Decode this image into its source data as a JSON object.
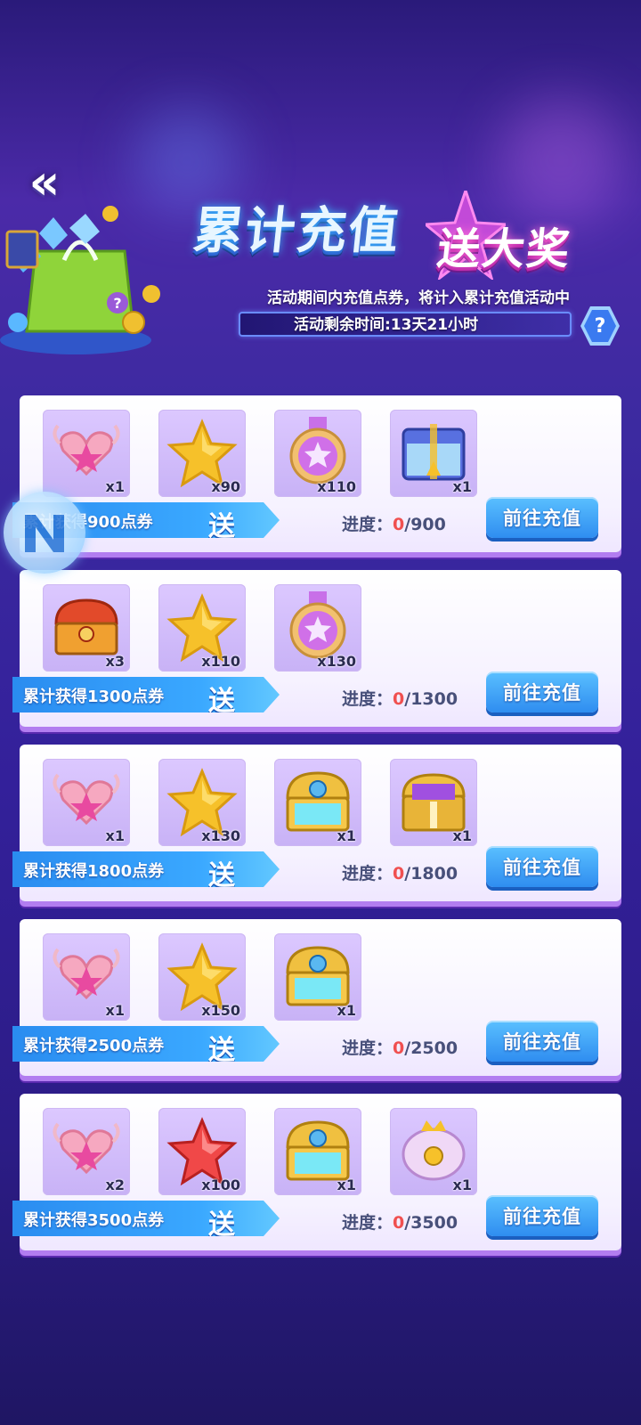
{
  "header": {
    "back_icon": "double-chevron-left-icon",
    "title": "累计充值",
    "subtitle": "送大奖",
    "info": "活动期间内充值点券，将计入累计充值活动中",
    "timer": "活动剩余时间:13天21小时",
    "help_label": "?"
  },
  "tiers": [
    {
      "ribbon": "累计获得900点券",
      "send": "送",
      "progress_label": "进度：",
      "progress_current": "0",
      "progress_target": "/900",
      "button": "前往充值",
      "items": [
        {
          "icon": "wing-heart-icon",
          "qty": "x1"
        },
        {
          "icon": "gold-star-icon",
          "qty": "x90"
        },
        {
          "icon": "star-medal-icon",
          "qty": "x110"
        },
        {
          "icon": "blue-chest-icon",
          "qty": "x1"
        }
      ]
    },
    {
      "ribbon": "累计获得1300点券",
      "send": "送",
      "progress_label": "进度：",
      "progress_current": "0",
      "progress_target": "/1300",
      "button": "前往充值",
      "items": [
        {
          "icon": "red-chest-icon",
          "qty": "x3"
        },
        {
          "icon": "gold-star-icon",
          "qty": "x110"
        },
        {
          "icon": "star-medal-icon",
          "qty": "x130"
        }
      ]
    },
    {
      "ribbon": "累计获得1800点券",
      "send": "送",
      "progress_label": "进度：",
      "progress_current": "0",
      "progress_target": "/1800",
      "button": "前往充值",
      "items": [
        {
          "icon": "wing-heart-icon",
          "qty": "x1"
        },
        {
          "icon": "gold-star-icon",
          "qty": "x130"
        },
        {
          "icon": "gold-crystal-chest-icon",
          "qty": "x1"
        },
        {
          "icon": "purple-gold-chest-icon",
          "qty": "x1"
        }
      ]
    },
    {
      "ribbon": "累计获得2500点券",
      "send": "送",
      "progress_label": "进度：",
      "progress_current": "0",
      "progress_target": "/2500",
      "button": "前往充值",
      "items": [
        {
          "icon": "wing-heart-icon",
          "qty": "x1"
        },
        {
          "icon": "gold-star-icon",
          "qty": "x150"
        },
        {
          "icon": "gold-crystal-chest-icon",
          "qty": "x1"
        }
      ]
    },
    {
      "ribbon": "累计获得3500点券",
      "send": "送",
      "progress_label": "进度：",
      "progress_current": "0",
      "progress_target": "/3500",
      "button": "前往充值",
      "items": [
        {
          "icon": "wing-heart-icon",
          "qty": "x2"
        },
        {
          "icon": "red-star-icon",
          "qty": "x100"
        },
        {
          "icon": "gold-crystal-chest-icon",
          "qty": "x1"
        },
        {
          "icon": "pink-crown-chest-icon",
          "qty": "x1"
        }
      ]
    }
  ],
  "colors": {
    "accent": "#3aa8ff",
    "progress_current": "#f05050",
    "card_border": "#b27df0"
  }
}
